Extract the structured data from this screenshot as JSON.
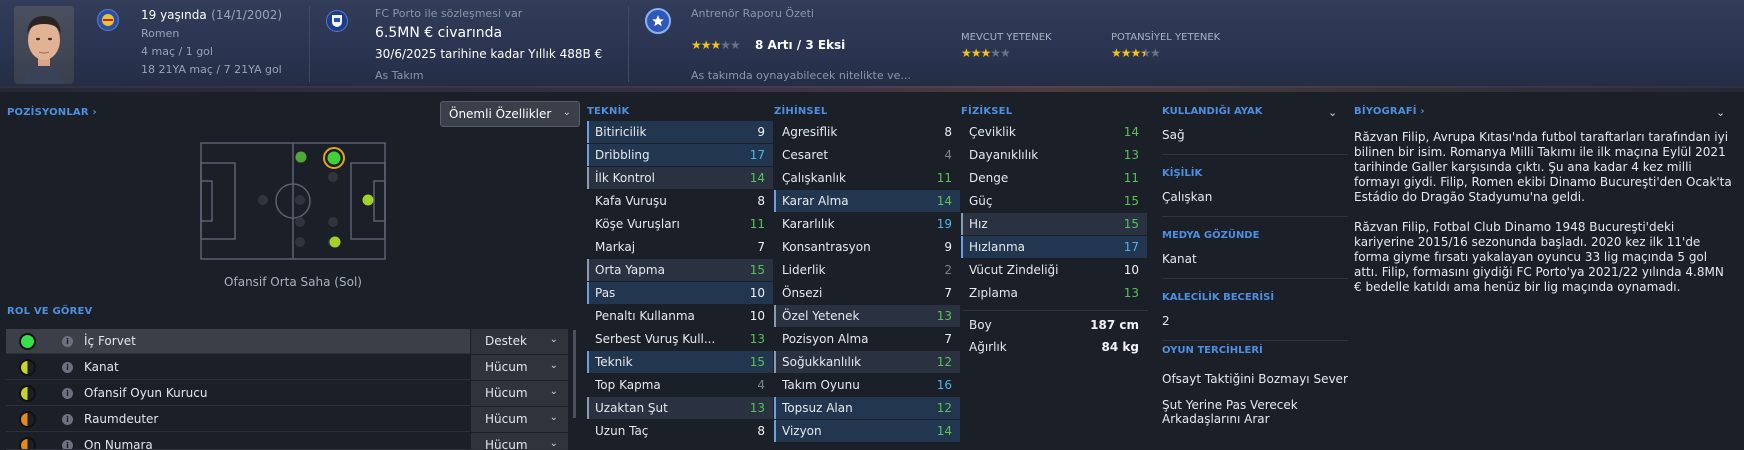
{
  "header": {
    "age": "19 yaşında",
    "birth": "(14/1/2002)",
    "nationality": "Romen",
    "caps": "4 maç / 1 gol",
    "u21": "18 21YA maç / 7 21YA gol",
    "club_line": "FC Porto ile sözleşmesi var",
    "value": "6.5MN € civarında",
    "contract": "30/6/2025 tarihine kadar Yıllık 488B €",
    "squad": "As Takım",
    "coach_report_title": "Antrenör Raporu Özeti",
    "coach_stars": 3,
    "pros_cons": "8 Artı / 3 Eksi",
    "report_summary": "As takımda oynayabilecek nitelikte ve...",
    "current_ability_label": "MEVCUT YETENEK",
    "current_ability_stars": 3,
    "potential_ability_label": "POTANSİYEL YETENEK",
    "potential_ability_stars": 3.5
  },
  "positions": {
    "title": "POZİSYONLAR ›",
    "filter": "Önemli Özellikler",
    "caption": "Ofansif Orta Saha (Sol)"
  },
  "roles": {
    "title": "ROL VE GÖREV",
    "items": [
      {
        "name": "İç Forvet",
        "duty": "Destek",
        "color": "#35e04a"
      },
      {
        "name": "Kanat",
        "duty": "Hücum",
        "color": "#c9d42a"
      },
      {
        "name": "Ofansif Oyun Kurucu",
        "duty": "Hücum",
        "color": "#c9d42a"
      },
      {
        "name": "Raumdeuter",
        "duty": "Hücum",
        "color": "#e08a1f"
      },
      {
        "name": "On Numara",
        "duty": "Hücum",
        "color": "#e08a1f"
      }
    ]
  },
  "technical": {
    "title": "TEKNİK",
    "items": [
      {
        "name": "Bitiricilik",
        "value": "9"
      },
      {
        "name": "Dribbling",
        "value": "17"
      },
      {
        "name": "İlk Kontrol",
        "value": "14"
      },
      {
        "name": "Kafa Vuruşu",
        "value": "8"
      },
      {
        "name": "Köşe Vuruşları",
        "value": "11"
      },
      {
        "name": "Markaj",
        "value": "7"
      },
      {
        "name": "Orta Yapma",
        "value": "15"
      },
      {
        "name": "Pas",
        "value": "10"
      },
      {
        "name": "Penaltı Kullanma",
        "value": "10"
      },
      {
        "name": "Serbest Vuruş Kull...",
        "value": "13"
      },
      {
        "name": "Teknik",
        "value": "15"
      },
      {
        "name": "Top Kapma",
        "value": "4"
      },
      {
        "name": "Uzaktan Şut",
        "value": "13"
      },
      {
        "name": "Uzun Taç",
        "value": "8"
      }
    ]
  },
  "mental": {
    "title": "ZİHİNSEL",
    "items": [
      {
        "name": "Agresiflik",
        "value": "8"
      },
      {
        "name": "Cesaret",
        "value": "4"
      },
      {
        "name": "Çalışkanlık",
        "value": "11"
      },
      {
        "name": "Karar Alma",
        "value": "14"
      },
      {
        "name": "Kararlılık",
        "value": "19"
      },
      {
        "name": "Konsantrasyon",
        "value": "9"
      },
      {
        "name": "Liderlik",
        "value": "2"
      },
      {
        "name": "Önsezi",
        "value": "7"
      },
      {
        "name": "Özel Yetenek",
        "value": "13"
      },
      {
        "name": "Pozisyon Alma",
        "value": "7"
      },
      {
        "name": "Soğukkanlılık",
        "value": "12"
      },
      {
        "name": "Takım Oyunu",
        "value": "16"
      },
      {
        "name": "Topsuz Alan",
        "value": "12"
      },
      {
        "name": "Vizyon",
        "value": "14"
      }
    ]
  },
  "physical": {
    "title": "FİZİKSEL",
    "items": [
      {
        "name": "Çeviklik",
        "value": "14"
      },
      {
        "name": "Dayanıklılık",
        "value": "13"
      },
      {
        "name": "Denge",
        "value": "11"
      },
      {
        "name": "Güç",
        "value": "15"
      },
      {
        "name": "Hız",
        "value": "15"
      },
      {
        "name": "Hızlanma",
        "value": "17"
      },
      {
        "name": "Vücut Zindeliği",
        "value": "10"
      },
      {
        "name": "Zıplama",
        "value": "13"
      }
    ],
    "height_label": "Boy",
    "height": "187 cm",
    "weight_label": "Ağırlık",
    "weight": "84 kg"
  },
  "info": {
    "foot_title": "KULLANDIĞI AYAK",
    "foot": "Sağ",
    "personality_title": "KİŞİLİK",
    "personality": "Çalışkan",
    "media_title": "MEDYA GÖZÜNDE",
    "media": "Kanat",
    "gk_title": "KALECİLİK BECERİSİ",
    "gk": "2",
    "prefs_title": "OYUN TERCİHLERİ",
    "pref1": "Ofsayt Taktiğini Bozmayı Sever",
    "pref2a": "Şut Yerine Pas Verecek",
    "pref2b": "Arkadaşlarını Arar"
  },
  "bio": {
    "title": "BİYOGRAFİ ›",
    "p1": "Răzvan Filip, Avrupa Kıtası'nda futbol taraftarları tarafından iyi bilinen bir isim. Romanya Milli Takımı ile ilk maçına Eylül 2021 tarihinde Galler karşısında çıktı. Şu ana kadar 4 kez milli formayı giydi. Filip, Romen ekibi Dinamo Bucureşti'den Ocak'ta Estádio do Dragão Stadyumu'na geldi.",
    "p2": "Răzvan Filip, Fotbal Club Dinamo 1948 Bucureşti'deki kariyerine 2015/16 sezonunda başladı. 2020 kez ilk 11'de forma giyme fırsatı yakalayan oyuncu 33 lig maçında 5 gol attı. Filip, formasını giydiği FC Porto'ya 2021/22 yılında 4.8MN € bedelle katıldı ama henüz bir lig maçında oynamadı."
  },
  "colors": {
    "accent": "#4f8fe0",
    "value_green": "#55c356",
    "value_blue": "#4fb2f0",
    "value_grey": "#7a8190"
  }
}
